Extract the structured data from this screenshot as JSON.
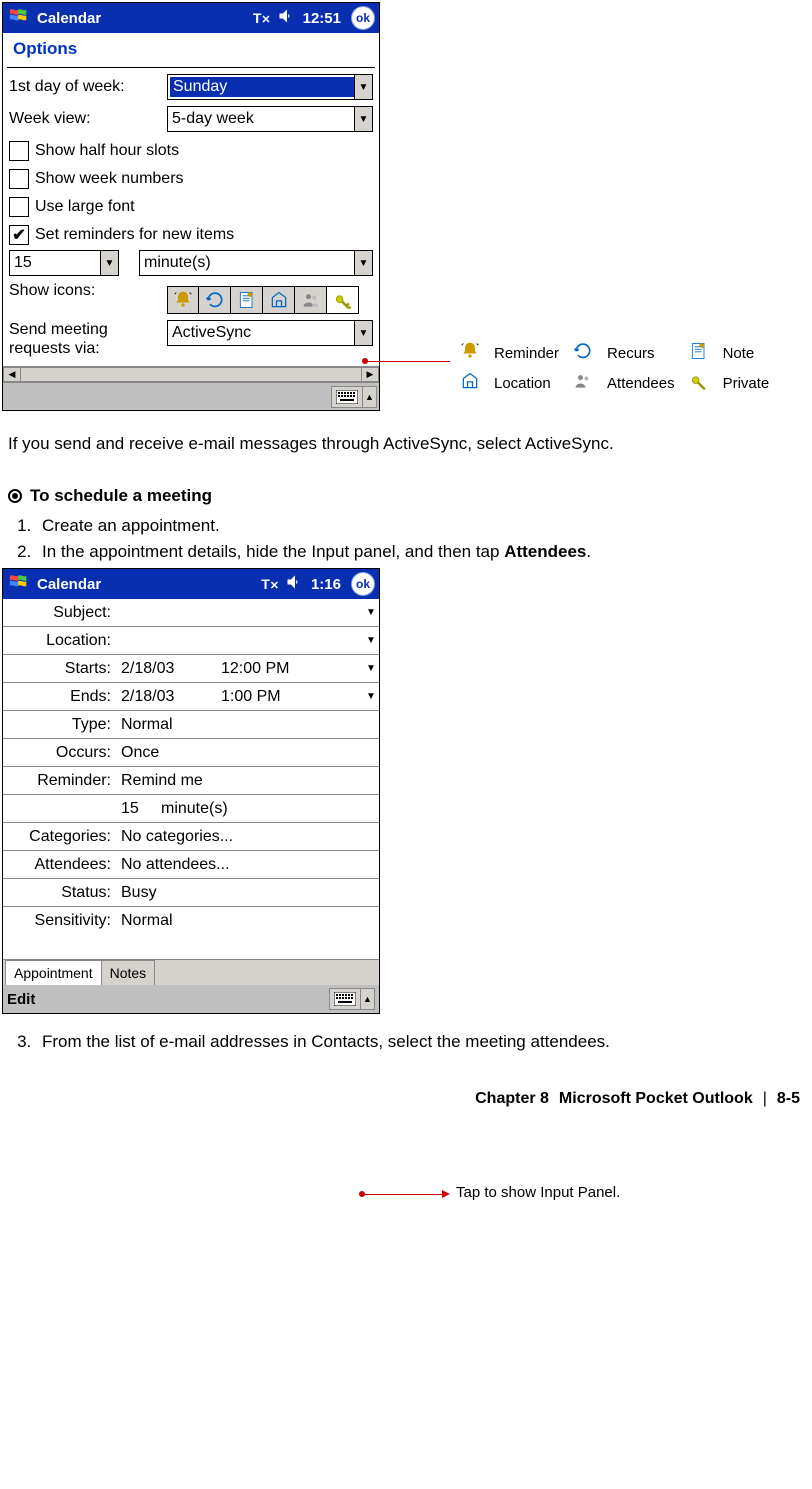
{
  "device1": {
    "title": "Calendar",
    "clock": "12:51",
    "ok": "ok",
    "options_header": "Options",
    "labels": {
      "first_day": "1st day of week:",
      "week_view": "Week view:",
      "show_half": "Show half hour slots",
      "show_week_nums": "Show week numbers",
      "use_large_font": "Use large font",
      "set_reminders": "Set reminders for new items",
      "show_icons": "Show icons:",
      "send_meeting": "Send meeting requests via:"
    },
    "values": {
      "first_day": "Sunday",
      "week_view": "5-day week",
      "reminder_qty": "15",
      "reminder_unit": "minute(s)",
      "send_via": "ActiveSync"
    },
    "checks": {
      "half": false,
      "weeknums": false,
      "largefont": false,
      "reminders": true
    }
  },
  "legend": {
    "reminder": "Reminder",
    "recurs": "Recurs",
    "note": "Note",
    "location": "Location",
    "attendees": "Attendees",
    "private": "Private"
  },
  "text": {
    "para1": "If you send and receive e-mail messages through ActiveSync, select ActiveSync.",
    "heading1": "To schedule a meeting",
    "step1": "Create an appointment.",
    "step2_a": "In the appointment details, hide the Input panel, and then tap ",
    "step2_b": "Attendees",
    "step2_c": ".",
    "step3": "From the list of e-mail addresses in Contacts, select the meeting attendees.",
    "callout_input": "Tap to show Input Panel."
  },
  "device2": {
    "title": "Calendar",
    "clock": "1:16",
    "ok": "ok",
    "rows": {
      "subject_lbl": "Subject:",
      "subject_val": "",
      "location_lbl": "Location:",
      "location_val": "",
      "starts_lbl": "Starts:",
      "starts_date": "2/18/03",
      "starts_time": "12:00 PM",
      "ends_lbl": "Ends:",
      "ends_date": "2/18/03",
      "ends_time": "1:00 PM",
      "type_lbl": "Type:",
      "type_val": "Normal",
      "occurs_lbl": "Occurs:",
      "occurs_val": "Once",
      "reminder_lbl": "Reminder:",
      "reminder_val": "Remind me",
      "reminder_qty": "15",
      "reminder_unit": "minute(s)",
      "categories_lbl": "Categories:",
      "categories_val": "No categories...",
      "attendees_lbl": "Attendees:",
      "attendees_val": "No attendees...",
      "status_lbl": "Status:",
      "status_val": "Busy",
      "sensitivity_lbl": "Sensitivity:",
      "sensitivity_val": "Normal"
    },
    "tabs": {
      "appt": "Appointment",
      "notes": "Notes"
    },
    "edit": "Edit"
  },
  "footer": {
    "chapter": "Chapter 8",
    "title": "Microsoft Pocket Outlook",
    "page": "8-5"
  }
}
